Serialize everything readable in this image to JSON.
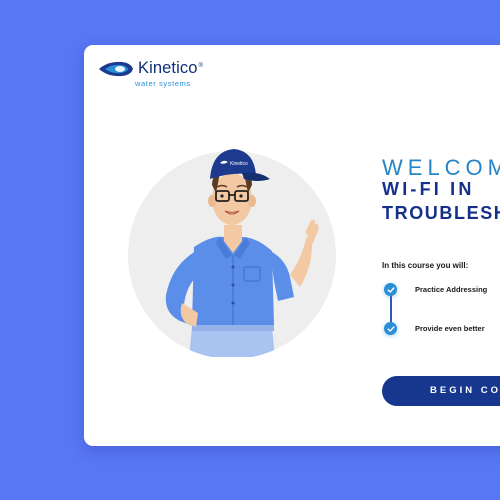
{
  "brand": {
    "name": "Kinetico",
    "trademark": "®",
    "tagline": "water systems"
  },
  "hero": {
    "welcome": "WELCOME",
    "title_line1": "WI-FI IN",
    "title_line2": "TROUBLESH"
  },
  "course": {
    "intro": "In this course you will:",
    "items": [
      {
        "label": "Practice Addressing",
        "icon": "check-icon"
      },
      {
        "label": "Provide even better",
        "icon": "check-icon"
      }
    ]
  },
  "cta": {
    "label": "BEGIN CO"
  },
  "colors": {
    "background": "#5877f5",
    "navy": "#14308a",
    "accent_blue": "#2a8fd6",
    "button": "#17378f"
  },
  "illustration": {
    "subject": "technician-avatar",
    "cap_logo_text": "Kinetico"
  }
}
